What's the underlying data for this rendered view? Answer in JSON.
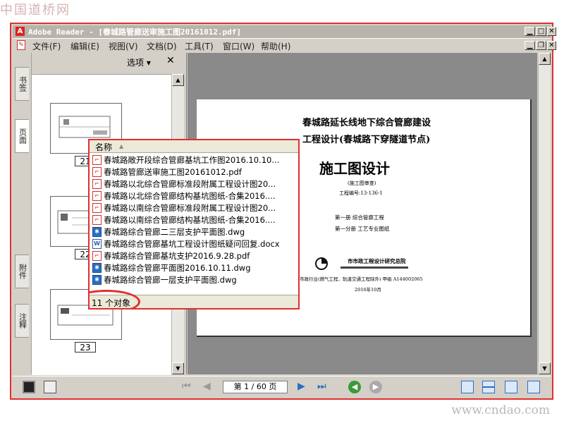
{
  "watermarks": {
    "top": "中国道桥网",
    "bottom": "www.cndao.com"
  },
  "window": {
    "title": "Adobe Reader - [春城路管廊送审施工图20161012.pdf]",
    "controls": [
      "_",
      "□",
      "✕"
    ]
  },
  "menu": {
    "items": [
      "文件(F)",
      "编辑(E)",
      "视图(V)",
      "文档(D)",
      "工具(T)",
      "窗口(W)",
      "帮助(H)"
    ]
  },
  "left_panel": {
    "tabs": [
      "书签",
      "页面",
      "附件",
      "注释"
    ],
    "options_label": "选项 ▾",
    "close_label": "✕",
    "thumbnails": [
      {
        "label": "21"
      },
      {
        "label": "22"
      },
      {
        "label": "23"
      }
    ]
  },
  "document_page": {
    "line1": "春城路延长线地下综合管廊建设",
    "line2": "工程设计(春城路下穿隧道节点)",
    "heading": "施工图设计",
    "sub1": "(施工图审查)",
    "sub2": "工程编号:13-136-1",
    "volume1": "第一册   综合管廊工程",
    "volume2": "第一分册  工艺专业图纸",
    "org": "市市政工程设计研究总院",
    "qualification": "市政行业(燃气工程、轨道交通工程除外)  甲级   A144002065",
    "date": "2016年10月"
  },
  "navigation": {
    "page_display": "第 1 / 60 页"
  },
  "file_popup": {
    "column_header": "名称",
    "files": [
      {
        "name": "春城路敞开段综合管廊基坑工作图2016.10.10...",
        "type": "pdf"
      },
      {
        "name": "春城路管廊送审施工图20161012.pdf",
        "type": "pdf"
      },
      {
        "name": "春城路以北综合管廊标准段附属工程设计图20...",
        "type": "pdf"
      },
      {
        "name": "春城路以北综合管廊结构基坑图纸-合集2016....",
        "type": "pdf"
      },
      {
        "name": "春城路以南综合管廊标准段附属工程设计图20...",
        "type": "pdf"
      },
      {
        "name": "春城路以南综合管廊结构基坑图纸-合集2016....",
        "type": "pdf"
      },
      {
        "name": "春城路综合管廊二三层支护平面图.dwg",
        "type": "dwg"
      },
      {
        "name": "春城路综合管廊基坑工程设计图纸疑问回复.docx",
        "type": "docx"
      },
      {
        "name": "春城路综合管廊基坑支护2016.9.28.pdf",
        "type": "pdf"
      },
      {
        "name": "春城路综合管廊平面图2016.10.11.dwg",
        "type": "dwg"
      },
      {
        "name": "春城路综合管廊一层支护平面图.dwg",
        "type": "dwg"
      }
    ],
    "count_text": "11 个对象"
  },
  "colors": {
    "highlight": "#e03030",
    "titlebar": "#b8b4ac",
    "chrome": "#d4d0c8",
    "doc_bg": "#8a8a8a"
  }
}
